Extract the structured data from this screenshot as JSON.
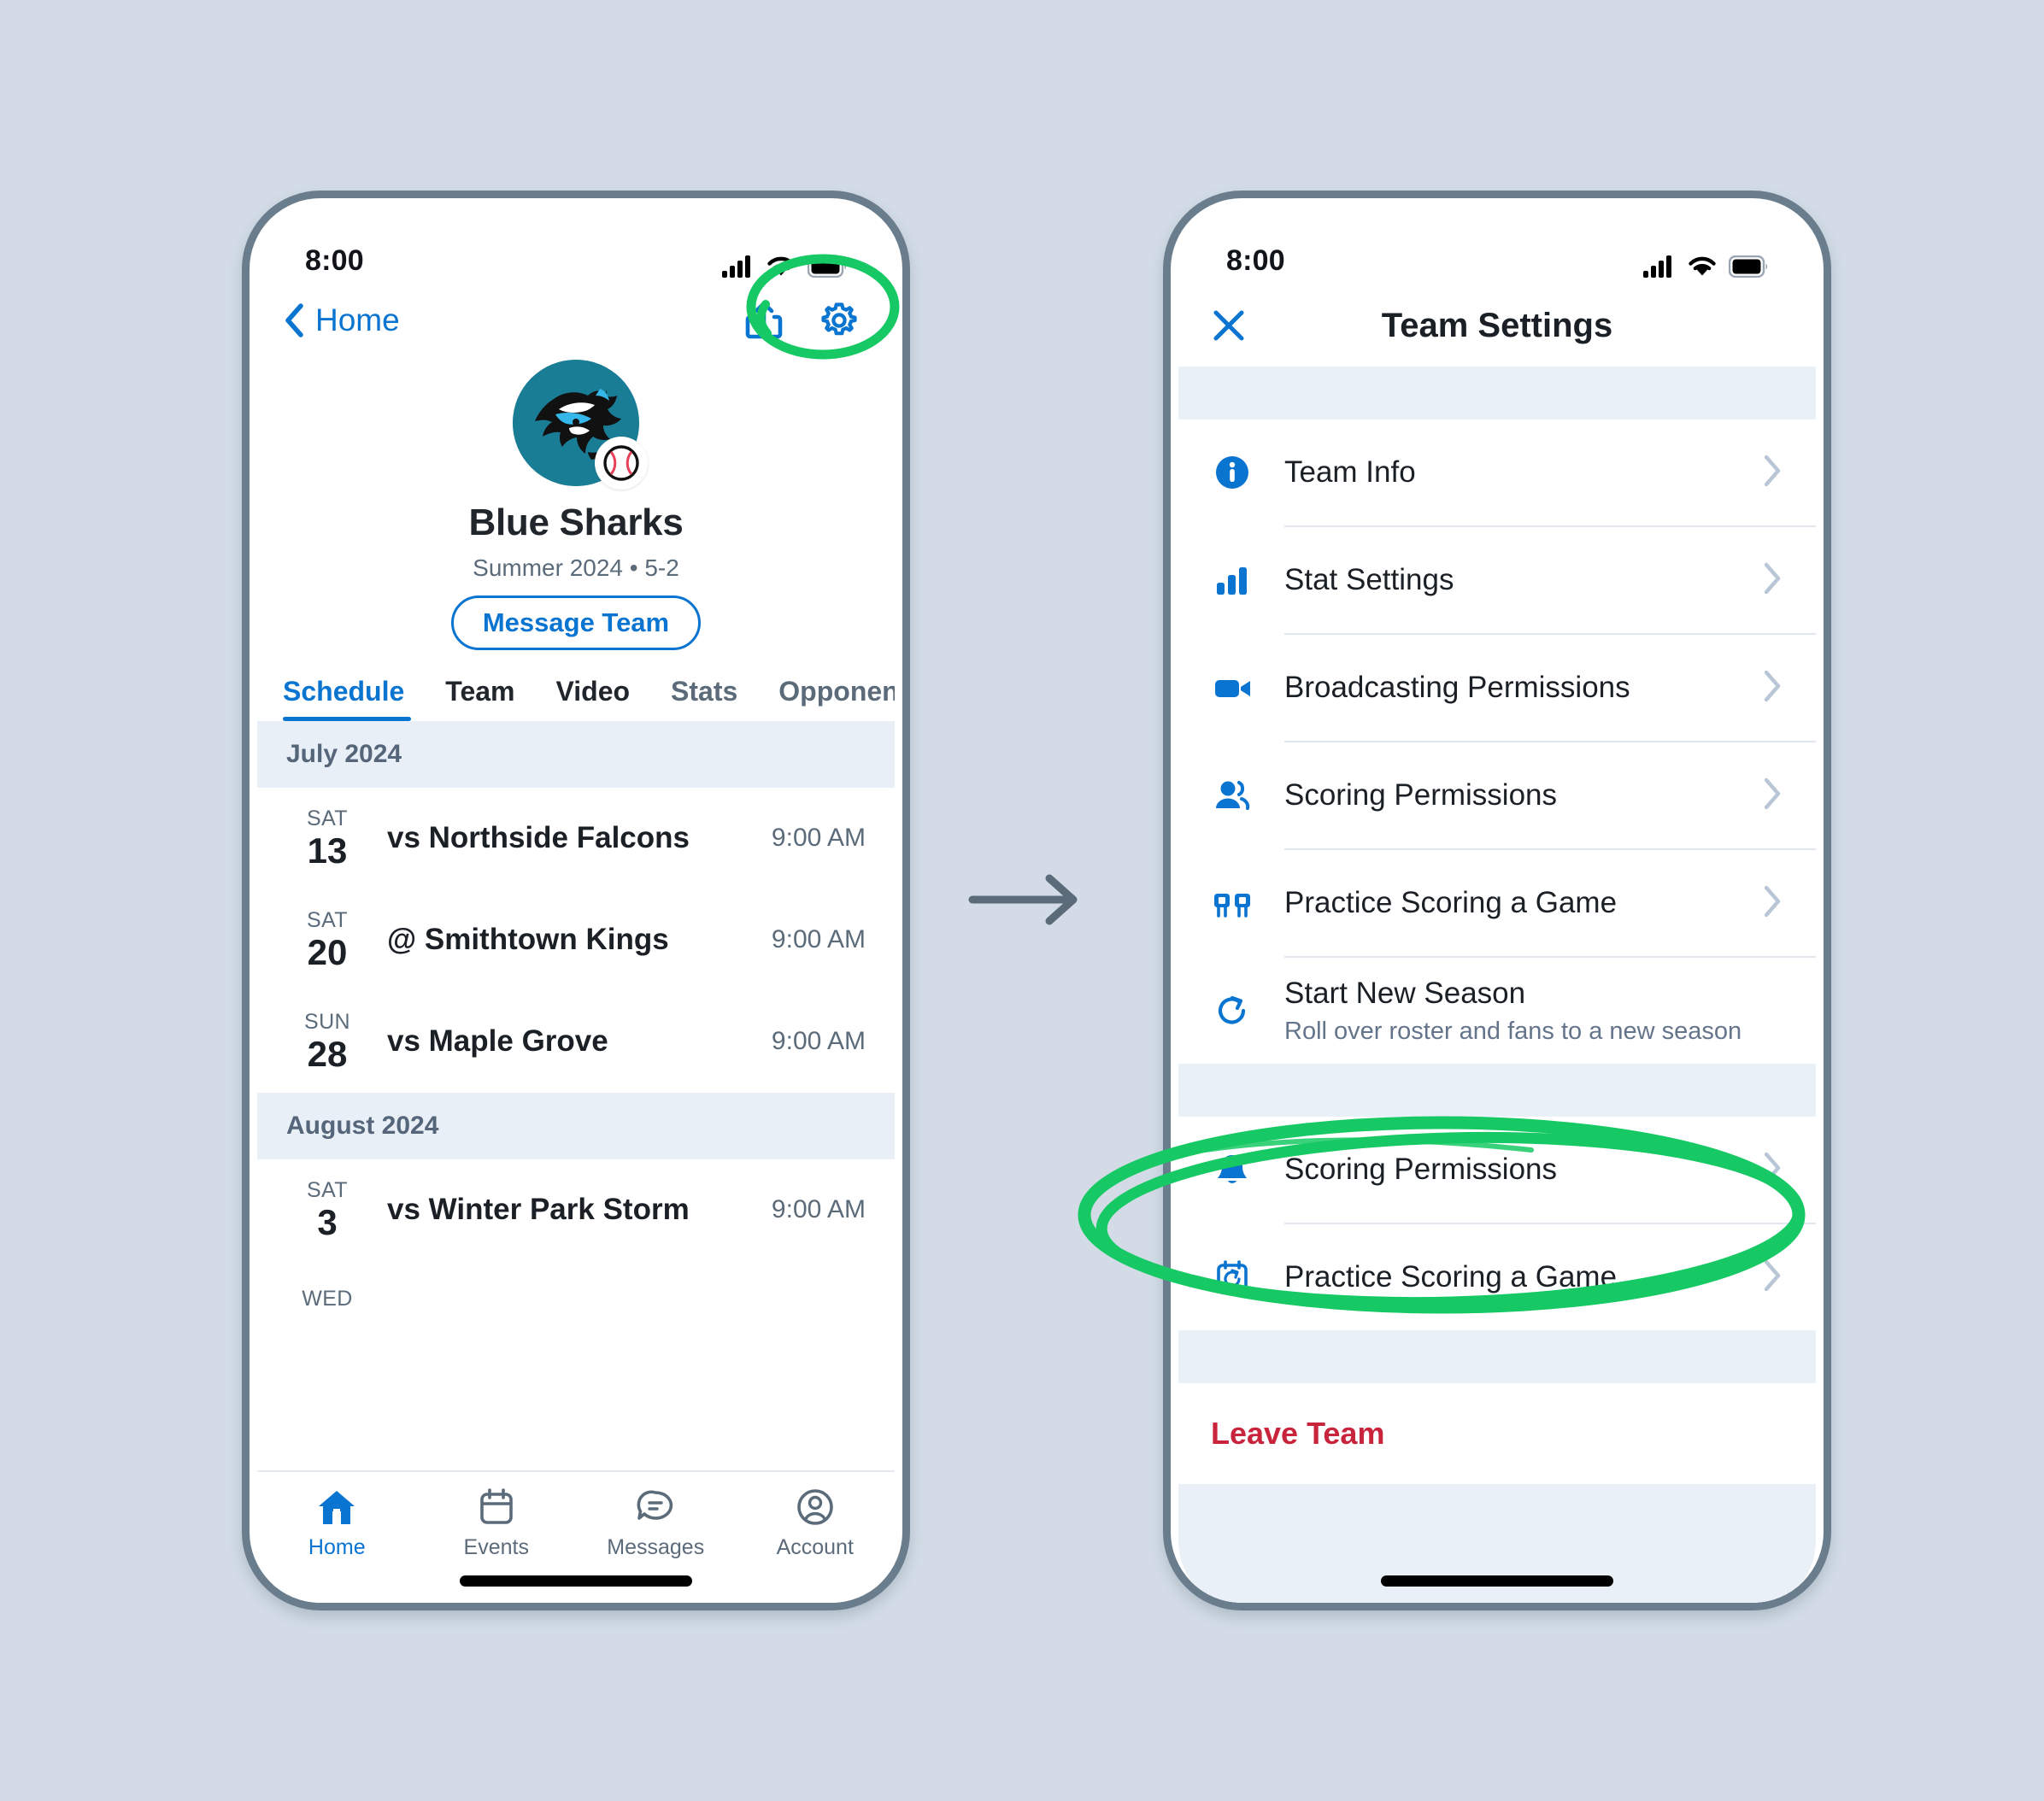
{
  "colors": {
    "background": "#d3dce6",
    "accent_blue": "#0a74d1",
    "annotation_green": "#17c964",
    "danger_red": "#c8243c",
    "team_teal": "#1a7d96",
    "muted_text": "#5c6b7a",
    "band": "#eaf0f7"
  },
  "left_phone": {
    "status": {
      "time": "8:00",
      "icons": [
        "cellular-signal-icon",
        "wifi-icon",
        "battery-icon"
      ]
    },
    "nav": {
      "back_label": "Home",
      "back_icon": "chevron-left-icon",
      "actions": [
        "share-icon",
        "gear-icon"
      ]
    },
    "team": {
      "avatar_icon": "shark-logo",
      "sport_badge_icon": "baseball-icon",
      "name": "Blue Sharks",
      "subtitle": "Summer 2024 • 5-2",
      "message_button": "Message Team"
    },
    "tabs": [
      {
        "label": "Schedule",
        "active": true
      },
      {
        "label": "Team",
        "active": false
      },
      {
        "label": "Video",
        "active": false
      },
      {
        "label": "Stats",
        "active": false
      },
      {
        "label": "Opponents",
        "active": false
      }
    ],
    "schedule": [
      {
        "month": "July 2024",
        "games": [
          {
            "dow": "SAT",
            "day": "13",
            "opponent": "vs Northside Falcons",
            "time": "9:00 AM"
          },
          {
            "dow": "SAT",
            "day": "20",
            "opponent": "@ Smithtown Kings",
            "time": "9:00 AM"
          },
          {
            "dow": "SUN",
            "day": "28",
            "opponent": "vs Maple Grove",
            "time": "9:00 AM"
          }
        ]
      },
      {
        "month": "August 2024",
        "games": [
          {
            "dow": "SAT",
            "day": "3",
            "opponent": "vs Winter Park Storm",
            "time": "9:00 AM"
          },
          {
            "dow": "WED",
            "day": "",
            "opponent": "",
            "time": ""
          }
        ]
      }
    ],
    "tabbar": [
      {
        "label": "Home",
        "icon": "home-icon",
        "active": true
      },
      {
        "label": "Events",
        "icon": "calendar-icon",
        "active": false
      },
      {
        "label": "Messages",
        "icon": "message-icon",
        "active": false
      },
      {
        "label": "Account",
        "icon": "account-icon",
        "active": false
      }
    ]
  },
  "right_phone": {
    "status": {
      "time": "8:00",
      "icons": [
        "cellular-signal-icon",
        "wifi-icon",
        "battery-icon"
      ]
    },
    "nav": {
      "close_icon": "close-icon",
      "title": "Team Settings"
    },
    "group_one": [
      {
        "label": "Team Info",
        "sub": "",
        "icon": "info-icon",
        "chevron": true
      },
      {
        "label": "Stat Settings",
        "sub": "",
        "icon": "bar-chart-icon",
        "chevron": true
      },
      {
        "label": "Broadcasting Permissions",
        "sub": "",
        "icon": "video-camera-icon",
        "chevron": true
      },
      {
        "label": "Scoring Permissions",
        "sub": "",
        "icon": "people-icon",
        "chevron": true
      },
      {
        "label": "Practice Scoring a Game",
        "sub": "",
        "icon": "scoreboard-icon",
        "chevron": true
      },
      {
        "label": "Start New Season",
        "sub": "Roll over roster and fans to a new season",
        "icon": "refresh-icon",
        "chevron": false
      }
    ],
    "group_two": [
      {
        "label": "Scoring Permissions",
        "sub": "",
        "icon": "bell-icon",
        "chevron": true
      },
      {
        "label": "Practice Scoring a Game",
        "sub": "",
        "icon": "calendar-refresh-icon",
        "chevron": true
      }
    ],
    "leave": {
      "label": "Leave Team"
    }
  },
  "annotations": {
    "gear_circle": "green-ellipse-highlight",
    "practice_circle": "green-ellipse-highlight",
    "flow_arrow": "right-arrow-icon"
  }
}
